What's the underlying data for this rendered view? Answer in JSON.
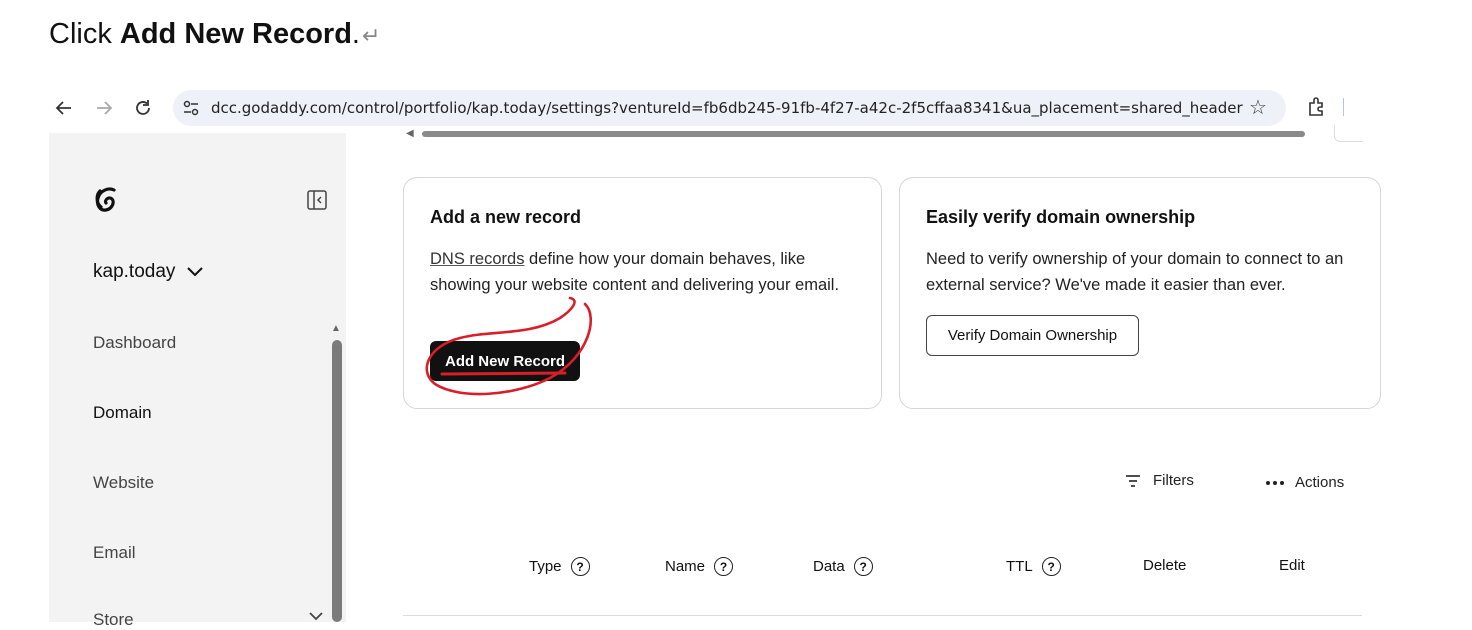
{
  "instruction": {
    "prefix": "Click ",
    "bold": "Add New Record",
    "suffix": ".",
    "return_mark": "↵"
  },
  "browser": {
    "url": "dcc.godaddy.com/control/portfolio/kap.today/settings?ventureId=fb6db245-91fb-4f27-a42c-2f5cffaa8341&ua_placement=shared_header",
    "icons": [
      "back-icon",
      "forward-icon",
      "reload-icon",
      "site-info-icon",
      "star-icon",
      "extensions-icon"
    ]
  },
  "sidebar": {
    "domain": "kap.today",
    "items": [
      {
        "label": "Dashboard"
      },
      {
        "label": "Domain"
      },
      {
        "label": "Website"
      },
      {
        "label": "Email"
      },
      {
        "label": "Store"
      }
    ]
  },
  "add_card": {
    "title": "Add a new record",
    "link": "DNS records",
    "text": " define how your domain behaves, like showing your website content and delivering your email.",
    "button": "Add New Record"
  },
  "verify_card": {
    "title": "Easily verify domain ownership",
    "text": "Need to verify ownership of your domain to connect to an external service? We've made it easier than ever.",
    "button": "Verify Domain Ownership"
  },
  "toolbar": {
    "filters": "Filters",
    "actions": "Actions"
  },
  "table": {
    "columns": [
      {
        "label": "Type",
        "help": "?"
      },
      {
        "label": "Name",
        "help": "?"
      },
      {
        "label": "Data",
        "help": "?"
      },
      {
        "label": "TTL",
        "help": "?"
      },
      {
        "label": "Delete"
      },
      {
        "label": "Edit"
      }
    ]
  },
  "colors": {
    "annotation": "#d81e28",
    "button_dark": "#111111",
    "sidebar_bg": "#f3f3f3"
  }
}
